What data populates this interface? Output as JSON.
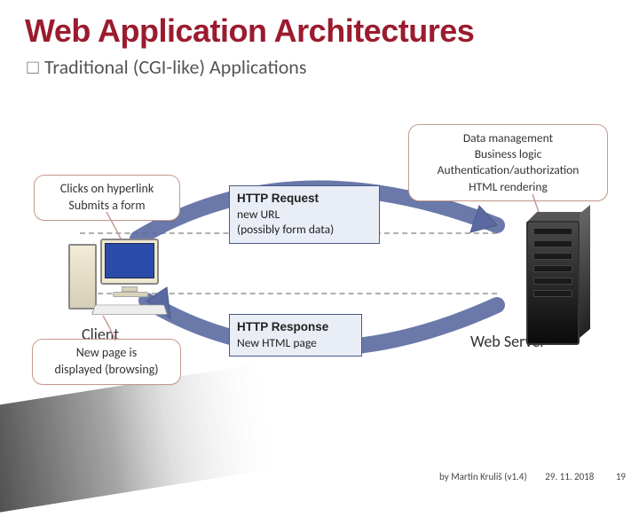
{
  "title": "Web Application Architectures",
  "subtitle_bullet": "□",
  "subtitle": "Traditional (CGI-like) Applications",
  "callouts": {
    "client_action": "Clicks on hyperlink\nSubmits a form",
    "server_role": "Data management\nBusiness logic\nAuthentication/authorization\nHTML rendering",
    "client_result": "New page is\ndisplayed (browsing)"
  },
  "messages": {
    "request": {
      "heading": "HTTP Request",
      "body": "new URL\n(possibly form data)"
    },
    "response": {
      "heading": "HTTP Response",
      "body": "New HTML page"
    }
  },
  "labels": {
    "client": "Client",
    "server": "Web Server"
  },
  "footer": {
    "author": "by Martin Kruliš (v1.4)",
    "date": "29. 11. 2018",
    "page": "19"
  }
}
